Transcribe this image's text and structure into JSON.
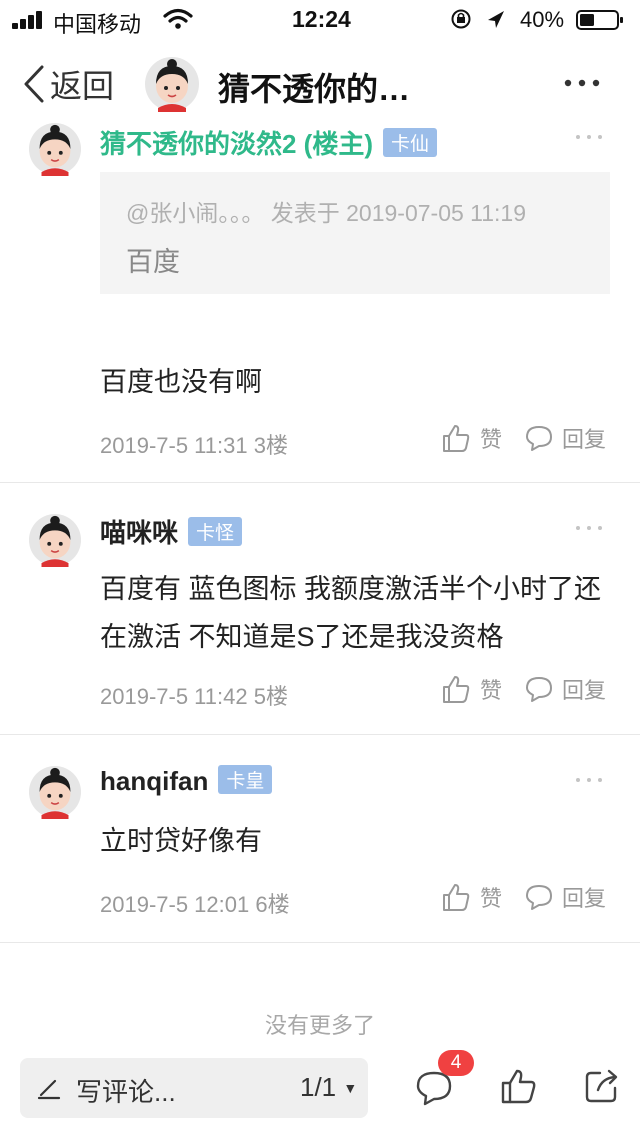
{
  "status_bar": {
    "carrier": "中国移动",
    "time": "12:24",
    "battery": "40%",
    "battery_level": 0.4
  },
  "nav": {
    "back_label": "返回",
    "title": "猜不透你的…"
  },
  "comments": [
    {
      "name": "猜不透你的淡然2 (楼主)",
      "badge": "卡仙",
      "quote_meta": "@张小闹。。。 发表于 2019-07-05 11:19",
      "quote_text": "百度",
      "text": "百度也没有啊",
      "meta": "2019-7-5 11:31  3楼",
      "like_label": "赞",
      "reply_label": "回复"
    },
    {
      "name": "喵咪咪",
      "badge": "卡怪",
      "text": "百度有 蓝色图标 我额度激活半个小时了还在激活 不知道是S了还是我没资格",
      "meta": "2019-7-5 11:42  5楼",
      "like_label": "赞",
      "reply_label": "回复"
    },
    {
      "name": "hanqifan",
      "badge": "卡皇",
      "text": "立时贷好像有",
      "meta": "2019-7-5 12:01  6楼",
      "like_label": "赞",
      "reply_label": "回复"
    }
  ],
  "no_more": "没有更多了",
  "bottom_bar": {
    "write_placeholder": "写评论...",
    "page_indicator": "1/1",
    "comment_count": "4"
  },
  "colors": {
    "op_name": "#2fb98a",
    "badge": "#9bbde9",
    "count_badge": "#f04141"
  },
  "icons": [
    "signal-icon",
    "wifi-icon",
    "lock-rotation-icon",
    "location-icon",
    "battery-icon",
    "back-chevron-icon",
    "more-icon",
    "thumbs-up-icon",
    "reply-bubble-icon",
    "pencil-icon",
    "dropdown-icon",
    "comment-icon",
    "like-icon",
    "share-icon"
  ]
}
